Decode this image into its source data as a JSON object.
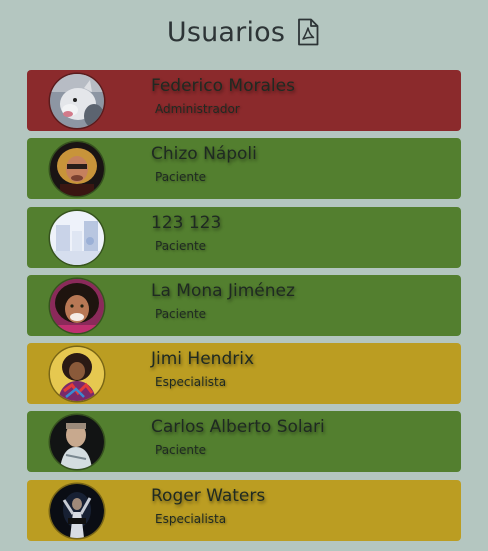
{
  "header": {
    "title": "Usuarios",
    "pdf_icon": "pdf-file-icon"
  },
  "colors": {
    "background": "#b4c6c0",
    "administrador": "#8b2a2c",
    "paciente": "#537f2f",
    "especialista": "#bb9d22"
  },
  "users": [
    {
      "name": "Federico Morales",
      "role": "Administrador"
    },
    {
      "name": "Chizo Nápoli",
      "role": "Paciente"
    },
    {
      "name": "123 123",
      "role": "Paciente"
    },
    {
      "name": "La Mona Jiménez",
      "role": "Paciente"
    },
    {
      "name": "Jimi Hendrix",
      "role": "Especialista"
    },
    {
      "name": "Carlos Alberto Solari",
      "role": "Paciente"
    },
    {
      "name": "Roger Waters",
      "role": "Especialista"
    }
  ]
}
